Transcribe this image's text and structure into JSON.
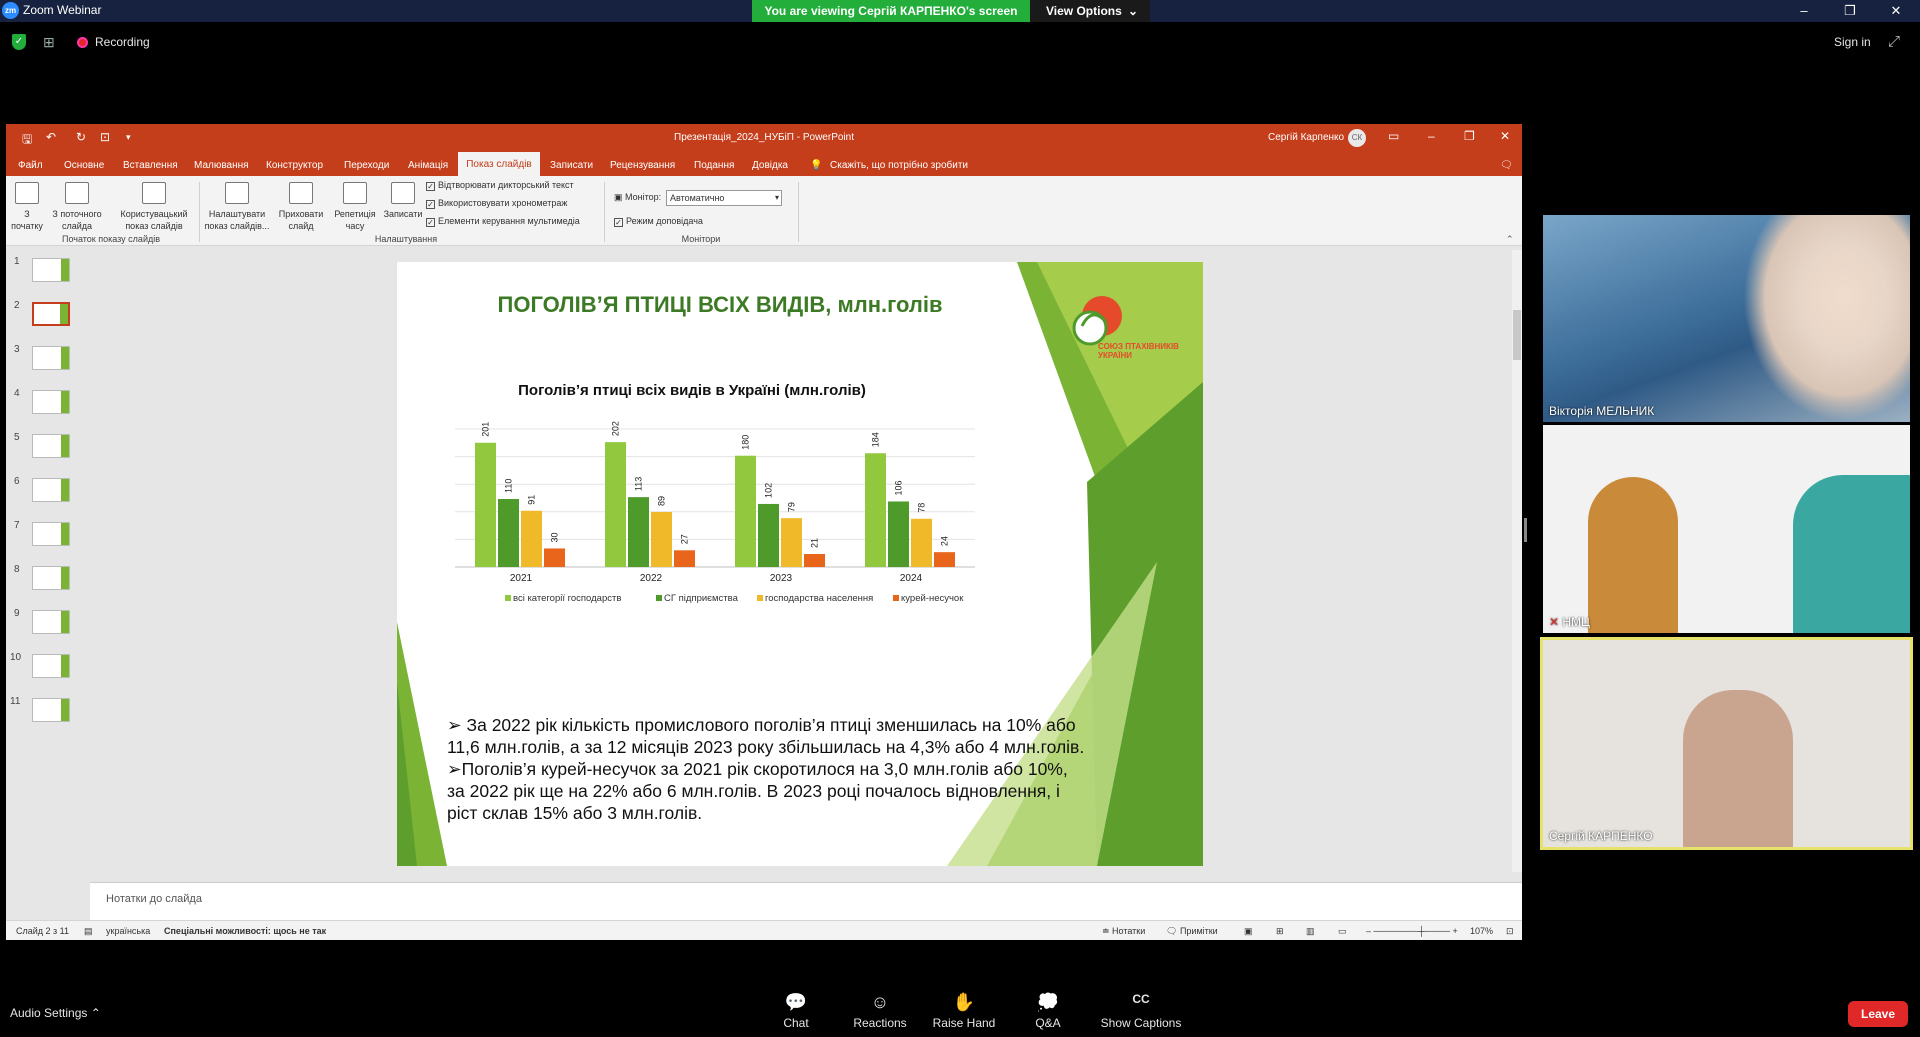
{
  "zoom": {
    "app_title": "Zoom Webinar",
    "viewing_banner": "You are viewing Сергій КАРПЕНКО's screen",
    "view_options": "View Options",
    "recording": "Recording",
    "sign_in": "Sign in",
    "audio_settings": "Audio Settings",
    "toolbar": [
      {
        "label": "Chat",
        "icon": "chat-icon"
      },
      {
        "label": "Reactions",
        "icon": "reactions-icon"
      },
      {
        "label": "Raise Hand",
        "icon": "raise-hand-icon"
      },
      {
        "label": "Q&A",
        "icon": "qa-icon"
      },
      {
        "label": "Show Captions",
        "icon": "cc-icon"
      }
    ],
    "leave": "Leave",
    "participants": [
      {
        "name": "Вікторія МЕЛЬНИК"
      },
      {
        "name": "НМЦ"
      },
      {
        "name": "Сергій КАРПЕНКО"
      }
    ]
  },
  "ppt": {
    "window_title": "Презентація_2024_НУБіП  -  PowerPoint",
    "user": "Сергій Карпенко",
    "user_initials": "СК",
    "tabs": [
      "Файл",
      "Основне",
      "Вставлення",
      "Малювання",
      "Конструктор",
      "Переходи",
      "Анімація",
      "Показ слайдів",
      "Записати",
      "Рецензування",
      "Подання",
      "Довідка"
    ],
    "active_tab": "Показ слайдів",
    "tell_me": "Скажіть, що потрібно зробити",
    "ribbon": {
      "from_start": "З початку",
      "from_current": "З поточного слайда",
      "custom_show": "Користувацький показ слайдів",
      "group_start": "Початок показу слайдів",
      "setup_show": "Налаштувати показ слайдів...",
      "hide_slide": "Приховати слайд",
      "rehearse": "Репетиція часу",
      "record": "Записати",
      "chk_narration": "Відтворювати дикторський текст",
      "chk_timings": "Використовувати хронометраж",
      "chk_media": "Елементи керування мультимедіа",
      "group_setup": "Налаштування",
      "monitor_label": "Монітор:",
      "monitor_value": "Автоматично",
      "chk_presenter": "Режим доповідача",
      "group_monitors": "Монітори"
    },
    "slide_numbers": [
      "1",
      "2",
      "3",
      "4",
      "5",
      "6",
      "7",
      "8",
      "9",
      "10",
      "11"
    ],
    "notes_placeholder": "Нотатки до слайда",
    "status": {
      "slide": "Слайд 2 з 11",
      "language": "українська",
      "accessibility": "Спеціальні можливості: щось не так",
      "notes": "Нотатки",
      "comments": "Примітки",
      "zoom": "107%"
    }
  },
  "slide": {
    "title": "ПОГОЛІВ’Я ПТИЦІ ВСІХ ВИДІВ, млн.голів",
    "logo_text": "СОЮЗ ПТАХІВНИКІВ УКРАЇНИ",
    "bullet1": "➢ За 2022 рік кількість промислового поголів’я птиці зменшилась на 10% або 11,6 млн.голів, а за 12 місяців 2023 року збільшилась на 4,3% або 4 млн.голів.",
    "bullet2": "➢Поголів’я курей-несучок за 2021 рік скоротилося на 3,0 млн.голів або 10%, за 2022 рік ще на 22% або 6 млн.голів. В 2023 році почалось відновлення, і ріст склав 15% або 3 млн.голів."
  },
  "chart_data": {
    "type": "bar",
    "title": "Поголів’я  птиці всіх видів в Україні (млн.голів)",
    "categories": [
      "2021",
      "2022",
      "2023",
      "2024"
    ],
    "series": [
      {
        "name": "всі категорії господарств",
        "values": [
          201,
          202,
          180,
          184
        ],
        "color": "#92c83e"
      },
      {
        "name": "СГ підприємства",
        "values": [
          110,
          113,
          102,
          106
        ],
        "color": "#4e9a2b"
      },
      {
        "name": "господарства населення",
        "values": [
          91,
          89,
          79,
          78
        ],
        "color": "#f0b92a"
      },
      {
        "name": "курей-несучок",
        "values": [
          30,
          27,
          21,
          24
        ],
        "color": "#e8651b"
      }
    ],
    "ylim": [
      0,
      250
    ],
    "grid": true,
    "legend": "bottom"
  }
}
